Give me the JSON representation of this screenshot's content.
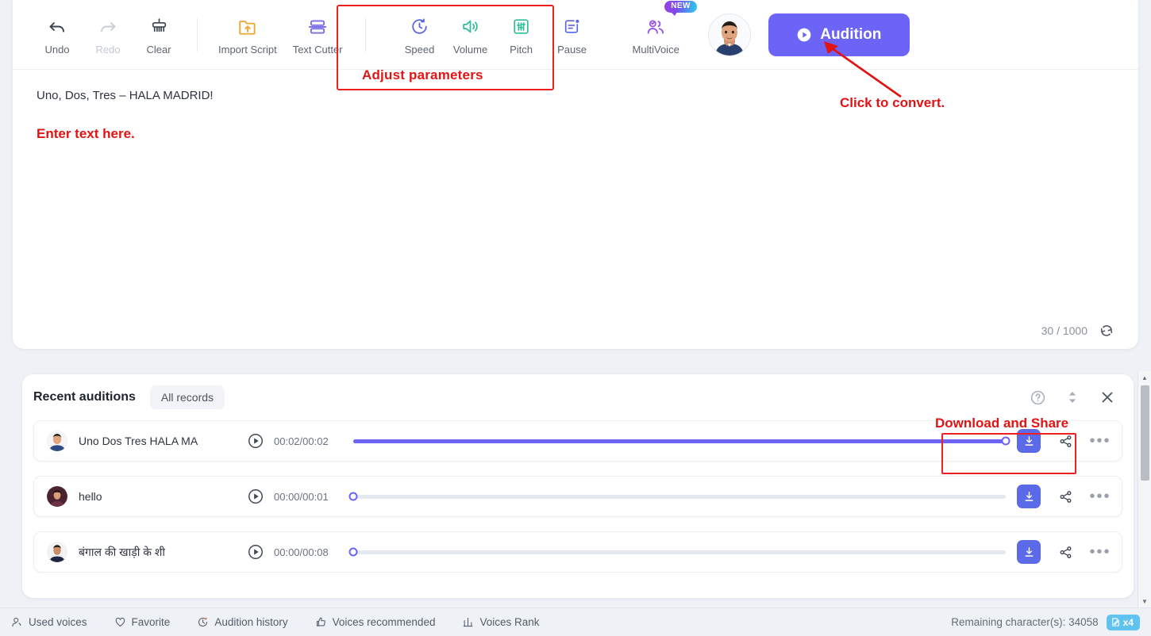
{
  "toolbar": {
    "tools": [
      {
        "label": "Undo",
        "icon": "undo-icon",
        "disabled": false
      },
      {
        "label": "Redo",
        "icon": "redo-icon",
        "disabled": true
      },
      {
        "label": "Clear",
        "icon": "clear-brush-icon",
        "disabled": false
      },
      {
        "label": "Import Script",
        "icon": "import-folder-icon",
        "disabled": false
      },
      {
        "label": "Text Cutter",
        "icon": "text-cutter-icon",
        "disabled": false
      }
    ],
    "params": [
      {
        "label": "Speed",
        "icon": "speed-icon"
      },
      {
        "label": "Volume",
        "icon": "volume-icon"
      },
      {
        "label": "Pitch",
        "icon": "pitch-icon"
      },
      {
        "label": "Pause",
        "icon": "pause-icon"
      }
    ],
    "multivoice": {
      "label": "MultiVoice",
      "badge": "NEW",
      "icon": "multivoice-icon"
    },
    "avatar": {
      "name": "voice-avatar"
    },
    "audition_button": {
      "label": "Audition",
      "icon": "play-icon",
      "color": "#6c63f7"
    }
  },
  "annotations": {
    "adjust_parameters": "Adjust parameters",
    "click_to_convert": "Click to convert.",
    "enter_text_here": "Enter text here.",
    "download_and_share": "Download and Share",
    "color": "#e01414"
  },
  "editor": {
    "text": "Uno, Dos, Tres – HALA MADRID!",
    "placeholder": "Enter text here.",
    "char_count": "30 / 1000",
    "refresh_icon": "refresh-icon"
  },
  "recent": {
    "title": "Recent auditions",
    "all_records_label": "All records",
    "icons": {
      "help": "help-circle-icon",
      "expand": "expand-collapse-icon",
      "close": "close-icon"
    },
    "rows": [
      {
        "name": "Uno Dos Tres HALA MA",
        "time": "00:02/00:02",
        "progress": 100,
        "avatar": "avatar-male-blue",
        "download_label": "download-icon",
        "share_label": "share-icon",
        "more_label": "more-options-icon"
      },
      {
        "name": "hello",
        "time": "00:00/00:01",
        "progress": 0,
        "avatar": "avatar-dark-red",
        "download_label": "download-icon",
        "share_label": "share-icon",
        "more_label": "more-options-icon"
      },
      {
        "name": "बंगाल की खाड़ी के शी",
        "time": "00:00/00:08",
        "progress": 0,
        "avatar": "avatar-male-navy",
        "download_label": "download-icon",
        "share_label": "share-icon",
        "more_label": "more-options-icon"
      }
    ]
  },
  "statusbar": {
    "items": [
      {
        "label": "Used voices",
        "icon": "user-voice-icon"
      },
      {
        "label": "Favorite",
        "icon": "heart-icon"
      },
      {
        "label": "Audition history",
        "icon": "history-clock-icon"
      },
      {
        "label": "Voices recommended",
        "icon": "thumbs-up-icon"
      },
      {
        "label": "Voices Rank",
        "icon": "bar-chart-icon"
      }
    ],
    "remaining": "Remaining character(s): 34058",
    "multiplier_badge": "x4"
  }
}
